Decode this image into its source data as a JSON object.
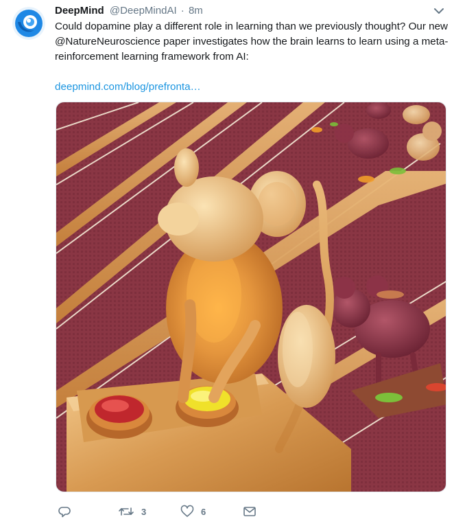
{
  "author": {
    "name": "DeepMind",
    "handle": "@DeepMindAI",
    "separator": "·",
    "time": "8m"
  },
  "tweet": {
    "text": "Could dopamine play a different role in learning than we previously thought? Our new @NatureNeuroscience paper investigates how the brain learns to learn using a meta-reinforcement learning framework from AI:",
    "link": "deepmind.com/blog/prefronta…"
  },
  "actions": {
    "reply_count": "",
    "retweet_count": "3",
    "like_count": "6"
  },
  "colors": {
    "link": "#1b95e0",
    "muted": "#657786",
    "avatar_blue": "#1e88e5"
  },
  "icons": {
    "caret": "chevron-down-icon",
    "reply": "reply-icon",
    "retweet": "retweet-icon",
    "like": "heart-icon",
    "message": "envelope-icon"
  }
}
